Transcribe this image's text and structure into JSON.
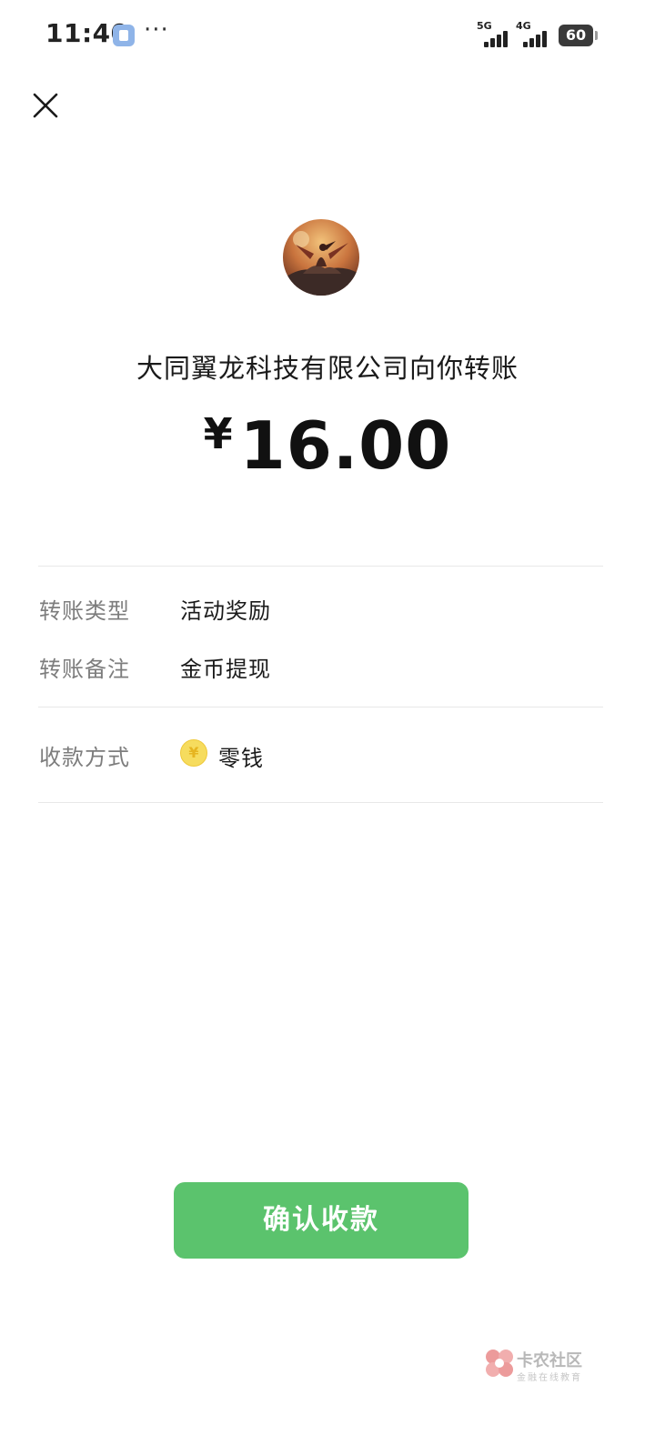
{
  "status_bar": {
    "time": "11:40",
    "more": "···",
    "signal_1_label": "5G",
    "signal_2_label": "4G",
    "battery": "60"
  },
  "icons": {
    "close": "close-icon",
    "avatar": "avatar-dragon-image",
    "wallet_method": "coin-icon"
  },
  "transfer": {
    "title": "大同翼龙科技有限公司向你转账",
    "currency_symbol": "¥",
    "amount": "16.00"
  },
  "details": {
    "type_label": "转账类型",
    "type_value": "活动奖励",
    "note_label": "转账备注",
    "note_value": "金币提现",
    "method_label": "收款方式",
    "method_coin_symbol": "¥",
    "method_value": "零钱"
  },
  "actions": {
    "confirm_label": "确认收款"
  },
  "watermark": {
    "name": "卡农社区",
    "slogan": "金融在线教育"
  },
  "colors": {
    "confirm_button": "#5bc36d",
    "coin": "#f6dc5e"
  }
}
